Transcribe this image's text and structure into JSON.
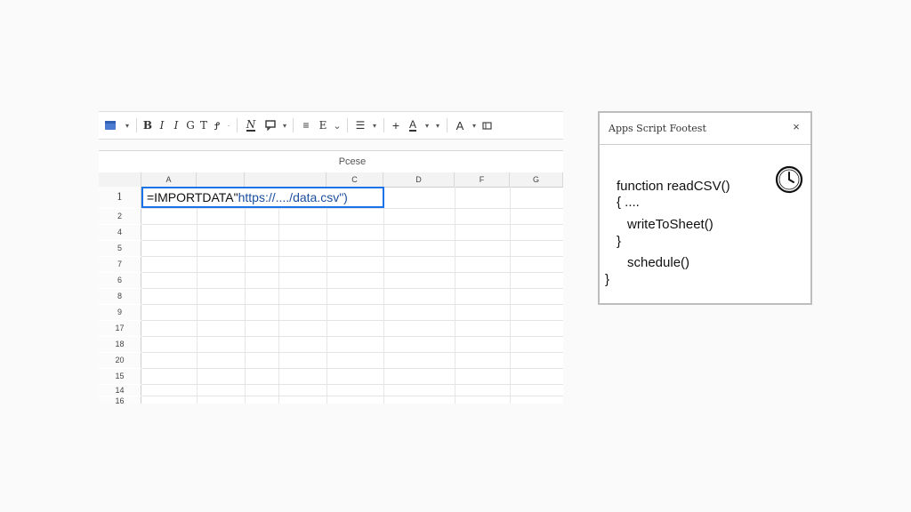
{
  "toolbar": {
    "items": [
      {
        "name": "sheet-icon"
      },
      {
        "name": "bold-button",
        "label": "B"
      },
      {
        "name": "italic-button",
        "label": "I"
      },
      {
        "name": "italic-alt-button",
        "label": "I"
      },
      {
        "name": "font-button",
        "label": "G"
      },
      {
        "name": "text-size-button",
        "label": "T"
      },
      {
        "name": "format-button",
        "label": "Ꝭ"
      },
      {
        "name": "underline-button",
        "label": "N"
      },
      {
        "name": "comment-icon"
      },
      {
        "name": "align-button",
        "label": "≡"
      },
      {
        "name": "wrap-button",
        "label": "E"
      },
      {
        "name": "list-button",
        "label": "☰"
      },
      {
        "name": "add-button",
        "label": "+"
      },
      {
        "name": "text-color-button",
        "label": "A"
      },
      {
        "name": "font-color-button",
        "label": "A"
      },
      {
        "name": "more-icon"
      }
    ]
  },
  "sheet": {
    "title": "Pcese",
    "columns": [
      "A",
      "",
      "",
      "C",
      "D",
      "F",
      "G"
    ],
    "rows": [
      "1",
      "2",
      "4",
      "5",
      "7",
      "6",
      "8",
      "9",
      "17",
      "18",
      "20",
      "15",
      "14",
      "16"
    ],
    "active_cell": {
      "function": "=IMPORTDATA\"",
      "argument": "https://..../data.csv\")"
    }
  },
  "script_panel": {
    "title": "Apps Script Footest",
    "close_label": "×",
    "code": [
      "function readCSV()",
      "{      ....",
      "writeToSheet()",
      "}",
      "schedule()",
      "}"
    ]
  }
}
